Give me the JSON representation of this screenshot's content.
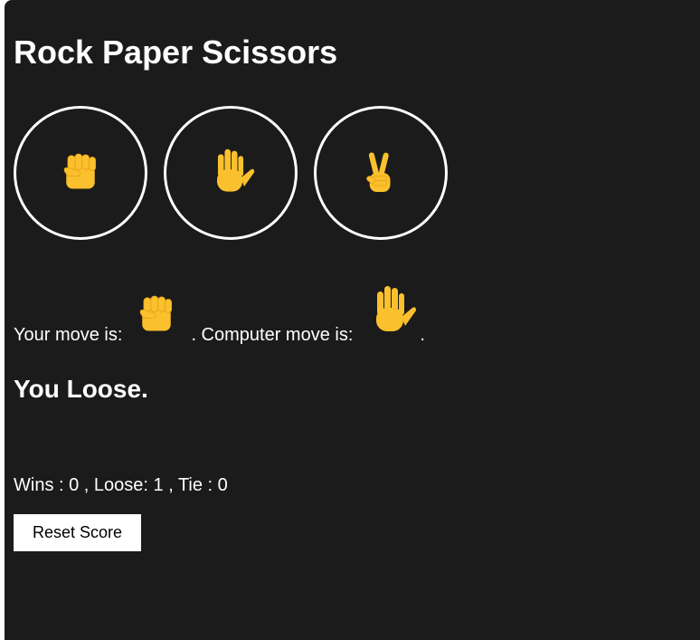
{
  "title": "Rock Paper Scissors",
  "moves": [
    {
      "name": "rock",
      "icon": "raised-fist-icon"
    },
    {
      "name": "paper",
      "icon": "raised-hand-icon"
    },
    {
      "name": "scissors",
      "icon": "victory-hand-icon"
    }
  ],
  "result": {
    "your_move_prefix": "Your move is:",
    "your_move_icon": "raised-fist-icon",
    "computer_move_prefix": ". Computer move is:",
    "computer_move_icon": "raised-hand-icon",
    "suffix": ".",
    "outcome": "You Loose."
  },
  "score": {
    "text": "Wins : 0 , Loose: 1 , Tie : 0"
  },
  "reset_label": "Reset Score",
  "colors": {
    "background": "#1b1b1b",
    "text": "#ffffff",
    "emoji_yellow": "#fbc02d",
    "emoji_shade": "#e8a317"
  }
}
